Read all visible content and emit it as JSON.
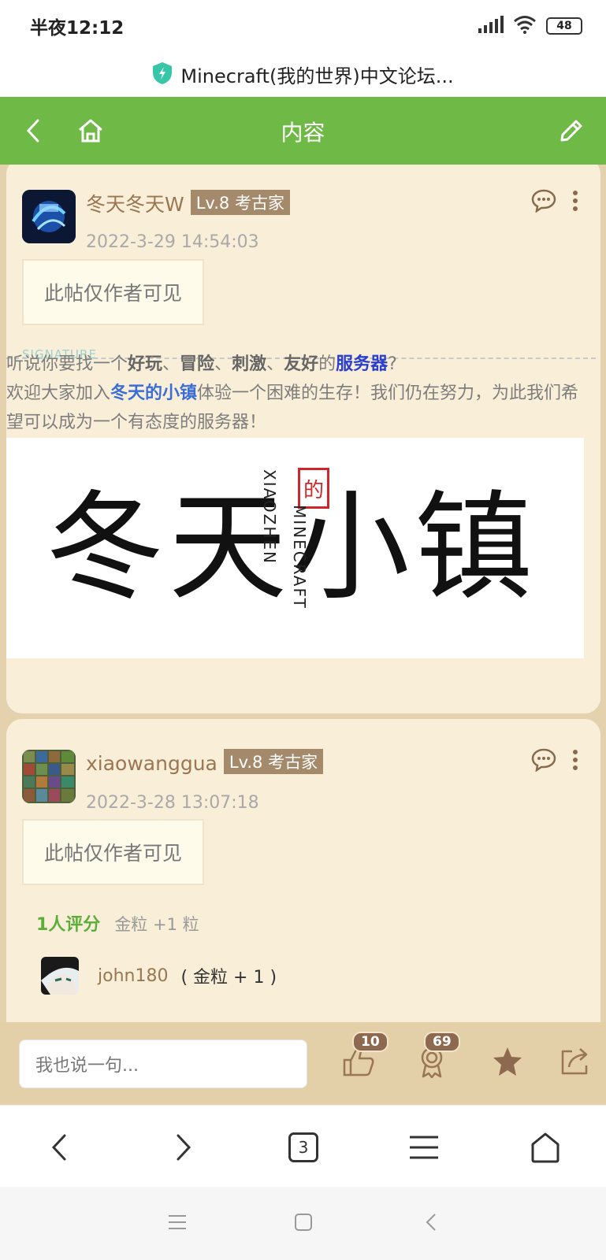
{
  "status_bar": {
    "time": "半夜12:12",
    "battery": "48"
  },
  "url_bar": {
    "title": "Minecraft(我的世界)中文论坛..."
  },
  "header": {
    "title": "内容"
  },
  "posts": [
    {
      "username": "冬天冬天W",
      "level": "Lv.8 考古家",
      "time": "2022-3-29 14:54:03",
      "hidden_notice": "此帖仅作者可见",
      "signature_label": "SIGNATURE",
      "signature": {
        "p1": "听说你要找一个",
        "b1": "好玩",
        "s1": "、",
        "b2": "冒险",
        "s2": "、",
        "b3": "刺激",
        "s3": "、",
        "b4": "友好",
        "p2": "的",
        "link1": "服务器",
        "p3": "?",
        "p4": "欢迎大家加入",
        "link2": "冬天的小镇",
        "p5": "体验一个困难的生存！我们仍在努力，为此我们希望可以成为一个有态度的服务器！"
      },
      "banner": {
        "main": "冬天小镇",
        "seal": "的",
        "vertical1": "XIAOZHEN",
        "vertical2": "MINECRAFT"
      }
    },
    {
      "username": "xiaowanggua",
      "level": "Lv.8 考古家",
      "time": "2022-3-28 13:07:18",
      "hidden_notice": "此帖仅作者可见",
      "rating_count": "1人评分",
      "rating_summary": "金粒 +1 粒",
      "raters": [
        {
          "name": "john180",
          "detail": "( 金粒 + 1 )"
        }
      ]
    }
  ],
  "bottom_bar": {
    "reply_placeholder": "我也说一句...",
    "like_count": "10",
    "award_count": "69"
  },
  "browser_nav": {
    "tab_count": "3"
  },
  "colors": {
    "header_green": "#6fba46",
    "card_bg": "#f9efd8",
    "accent_brown": "#8d6a4f"
  }
}
